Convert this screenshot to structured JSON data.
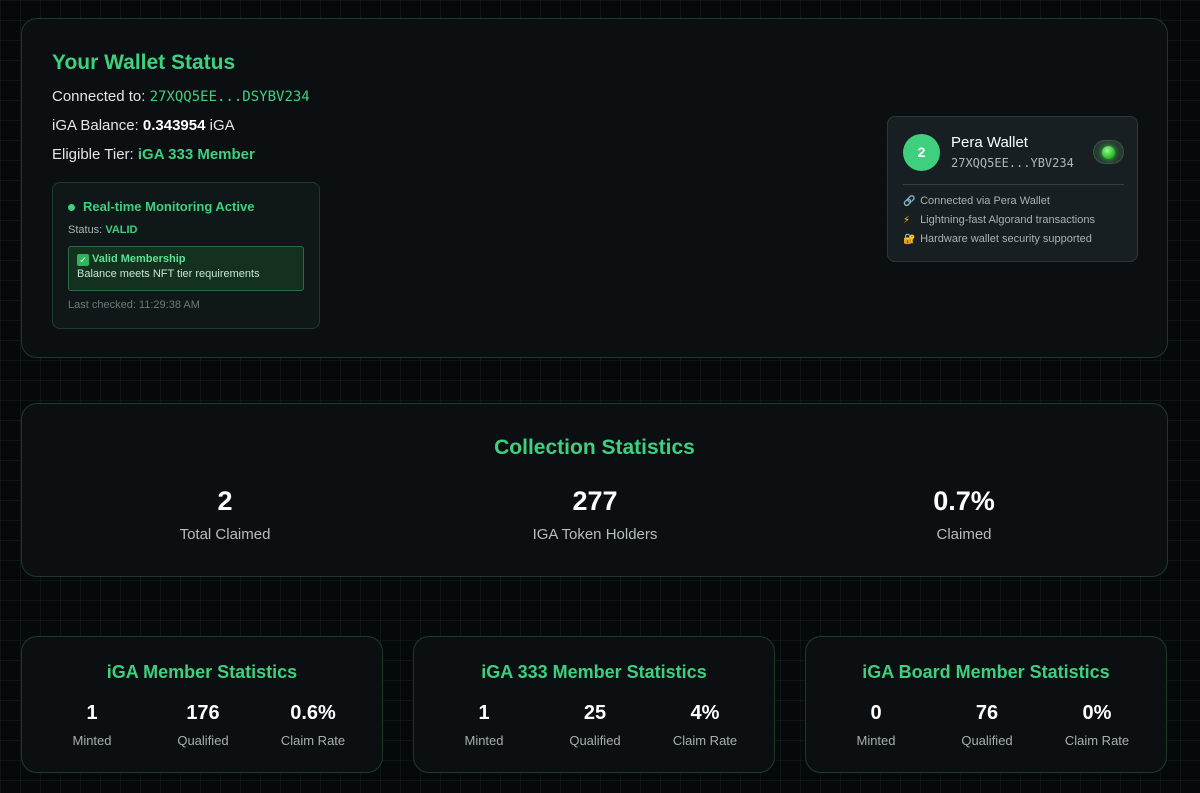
{
  "wallet_status": {
    "title": "Your Wallet Status",
    "connected_label": "Connected to:",
    "connected_address": "27XQQ5EE...DSYBV234",
    "balance_label": "iGA Balance:",
    "balance_value": "0.343954",
    "balance_unit": "iGA",
    "tier_label": "Eligible Tier:",
    "tier_value": "iGA 333 Member",
    "monitoring": {
      "title": "Real-time Monitoring Active",
      "status_label": "Status:",
      "status_value": "VALID",
      "valid_title": "Valid Membership",
      "valid_icon": "check-icon",
      "valid_desc": "Balance meets NFT tier requirements",
      "last_checked": "Last checked: 11:29:38 AM"
    }
  },
  "pera_wallet": {
    "avatar_text": "2",
    "name": "Pera Wallet",
    "address": "27XQQ5EE...YBV234",
    "status_color": "#34d34a",
    "features": [
      {
        "icon": "link-icon",
        "glyph": "🔗",
        "text": "Connected via Pera Wallet"
      },
      {
        "icon": "lightning-icon",
        "glyph": "⚡",
        "text": "Lightning-fast Algorand transactions"
      },
      {
        "icon": "lock-icon",
        "glyph": "🔐",
        "text": "Hardware wallet security supported"
      }
    ]
  },
  "collection_stats": {
    "title": "Collection Statistics",
    "items": [
      {
        "value": "2",
        "label": "Total Claimed"
      },
      {
        "value": "277",
        "label": "IGA Token Holders"
      },
      {
        "value": "0.7%",
        "label": "Claimed"
      }
    ]
  },
  "tiers": [
    {
      "title": "iGA Member Statistics",
      "stats": [
        {
          "value": "1",
          "label": "Minted"
        },
        {
          "value": "176",
          "label": "Qualified"
        },
        {
          "value": "0.6%",
          "label": "Claim Rate"
        }
      ]
    },
    {
      "title": "iGA 333 Member Statistics",
      "stats": [
        {
          "value": "1",
          "label": "Minted"
        },
        {
          "value": "25",
          "label": "Qualified"
        },
        {
          "value": "4%",
          "label": "Claim Rate"
        }
      ]
    },
    {
      "title": "iGA Board Member Statistics",
      "stats": [
        {
          "value": "0",
          "label": "Minted"
        },
        {
          "value": "76",
          "label": "Qualified"
        },
        {
          "value": "0%",
          "label": "Claim Rate"
        }
      ]
    }
  ],
  "colors": {
    "accent": "#3ecf7f",
    "background": "#06090b",
    "card": "#0b1013",
    "valid_box": "#14301f"
  }
}
